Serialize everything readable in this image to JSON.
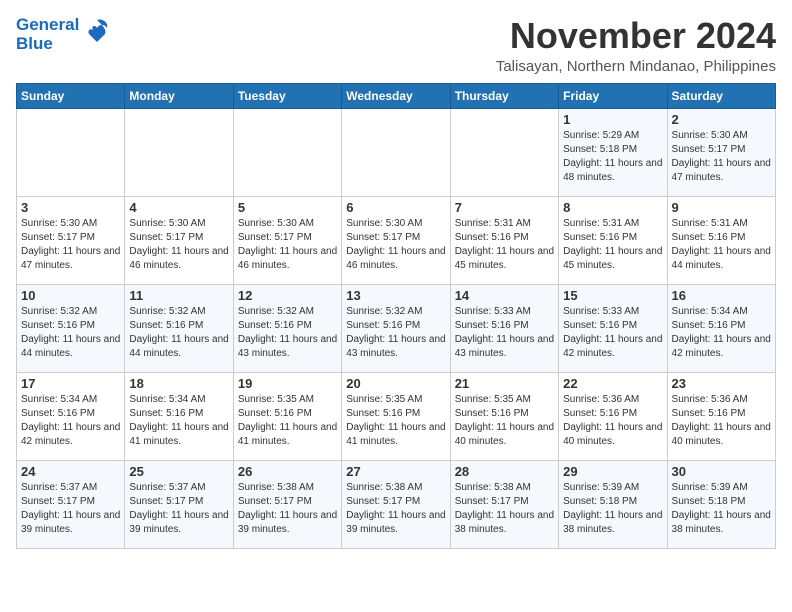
{
  "header": {
    "logo_line1": "General",
    "logo_line2": "Blue",
    "month": "November 2024",
    "location": "Talisayan, Northern Mindanao, Philippines"
  },
  "days_of_week": [
    "Sunday",
    "Monday",
    "Tuesday",
    "Wednesday",
    "Thursday",
    "Friday",
    "Saturday"
  ],
  "weeks": [
    [
      {
        "day": "",
        "info": ""
      },
      {
        "day": "",
        "info": ""
      },
      {
        "day": "",
        "info": ""
      },
      {
        "day": "",
        "info": ""
      },
      {
        "day": "",
        "info": ""
      },
      {
        "day": "1",
        "info": "Sunrise: 5:29 AM\nSunset: 5:18 PM\nDaylight: 11 hours and 48 minutes."
      },
      {
        "day": "2",
        "info": "Sunrise: 5:30 AM\nSunset: 5:17 PM\nDaylight: 11 hours and 47 minutes."
      }
    ],
    [
      {
        "day": "3",
        "info": "Sunrise: 5:30 AM\nSunset: 5:17 PM\nDaylight: 11 hours and 47 minutes."
      },
      {
        "day": "4",
        "info": "Sunrise: 5:30 AM\nSunset: 5:17 PM\nDaylight: 11 hours and 46 minutes."
      },
      {
        "day": "5",
        "info": "Sunrise: 5:30 AM\nSunset: 5:17 PM\nDaylight: 11 hours and 46 minutes."
      },
      {
        "day": "6",
        "info": "Sunrise: 5:30 AM\nSunset: 5:17 PM\nDaylight: 11 hours and 46 minutes."
      },
      {
        "day": "7",
        "info": "Sunrise: 5:31 AM\nSunset: 5:16 PM\nDaylight: 11 hours and 45 minutes."
      },
      {
        "day": "8",
        "info": "Sunrise: 5:31 AM\nSunset: 5:16 PM\nDaylight: 11 hours and 45 minutes."
      },
      {
        "day": "9",
        "info": "Sunrise: 5:31 AM\nSunset: 5:16 PM\nDaylight: 11 hours and 44 minutes."
      }
    ],
    [
      {
        "day": "10",
        "info": "Sunrise: 5:32 AM\nSunset: 5:16 PM\nDaylight: 11 hours and 44 minutes."
      },
      {
        "day": "11",
        "info": "Sunrise: 5:32 AM\nSunset: 5:16 PM\nDaylight: 11 hours and 44 minutes."
      },
      {
        "day": "12",
        "info": "Sunrise: 5:32 AM\nSunset: 5:16 PM\nDaylight: 11 hours and 43 minutes."
      },
      {
        "day": "13",
        "info": "Sunrise: 5:32 AM\nSunset: 5:16 PM\nDaylight: 11 hours and 43 minutes."
      },
      {
        "day": "14",
        "info": "Sunrise: 5:33 AM\nSunset: 5:16 PM\nDaylight: 11 hours and 43 minutes."
      },
      {
        "day": "15",
        "info": "Sunrise: 5:33 AM\nSunset: 5:16 PM\nDaylight: 11 hours and 42 minutes."
      },
      {
        "day": "16",
        "info": "Sunrise: 5:34 AM\nSunset: 5:16 PM\nDaylight: 11 hours and 42 minutes."
      }
    ],
    [
      {
        "day": "17",
        "info": "Sunrise: 5:34 AM\nSunset: 5:16 PM\nDaylight: 11 hours and 42 minutes."
      },
      {
        "day": "18",
        "info": "Sunrise: 5:34 AM\nSunset: 5:16 PM\nDaylight: 11 hours and 41 minutes."
      },
      {
        "day": "19",
        "info": "Sunrise: 5:35 AM\nSunset: 5:16 PM\nDaylight: 11 hours and 41 minutes."
      },
      {
        "day": "20",
        "info": "Sunrise: 5:35 AM\nSunset: 5:16 PM\nDaylight: 11 hours and 41 minutes."
      },
      {
        "day": "21",
        "info": "Sunrise: 5:35 AM\nSunset: 5:16 PM\nDaylight: 11 hours and 40 minutes."
      },
      {
        "day": "22",
        "info": "Sunrise: 5:36 AM\nSunset: 5:16 PM\nDaylight: 11 hours and 40 minutes."
      },
      {
        "day": "23",
        "info": "Sunrise: 5:36 AM\nSunset: 5:16 PM\nDaylight: 11 hours and 40 minutes."
      }
    ],
    [
      {
        "day": "24",
        "info": "Sunrise: 5:37 AM\nSunset: 5:17 PM\nDaylight: 11 hours and 39 minutes."
      },
      {
        "day": "25",
        "info": "Sunrise: 5:37 AM\nSunset: 5:17 PM\nDaylight: 11 hours and 39 minutes."
      },
      {
        "day": "26",
        "info": "Sunrise: 5:38 AM\nSunset: 5:17 PM\nDaylight: 11 hours and 39 minutes."
      },
      {
        "day": "27",
        "info": "Sunrise: 5:38 AM\nSunset: 5:17 PM\nDaylight: 11 hours and 39 minutes."
      },
      {
        "day": "28",
        "info": "Sunrise: 5:38 AM\nSunset: 5:17 PM\nDaylight: 11 hours and 38 minutes."
      },
      {
        "day": "29",
        "info": "Sunrise: 5:39 AM\nSunset: 5:18 PM\nDaylight: 11 hours and 38 minutes."
      },
      {
        "day": "30",
        "info": "Sunrise: 5:39 AM\nSunset: 5:18 PM\nDaylight: 11 hours and 38 minutes."
      }
    ]
  ]
}
